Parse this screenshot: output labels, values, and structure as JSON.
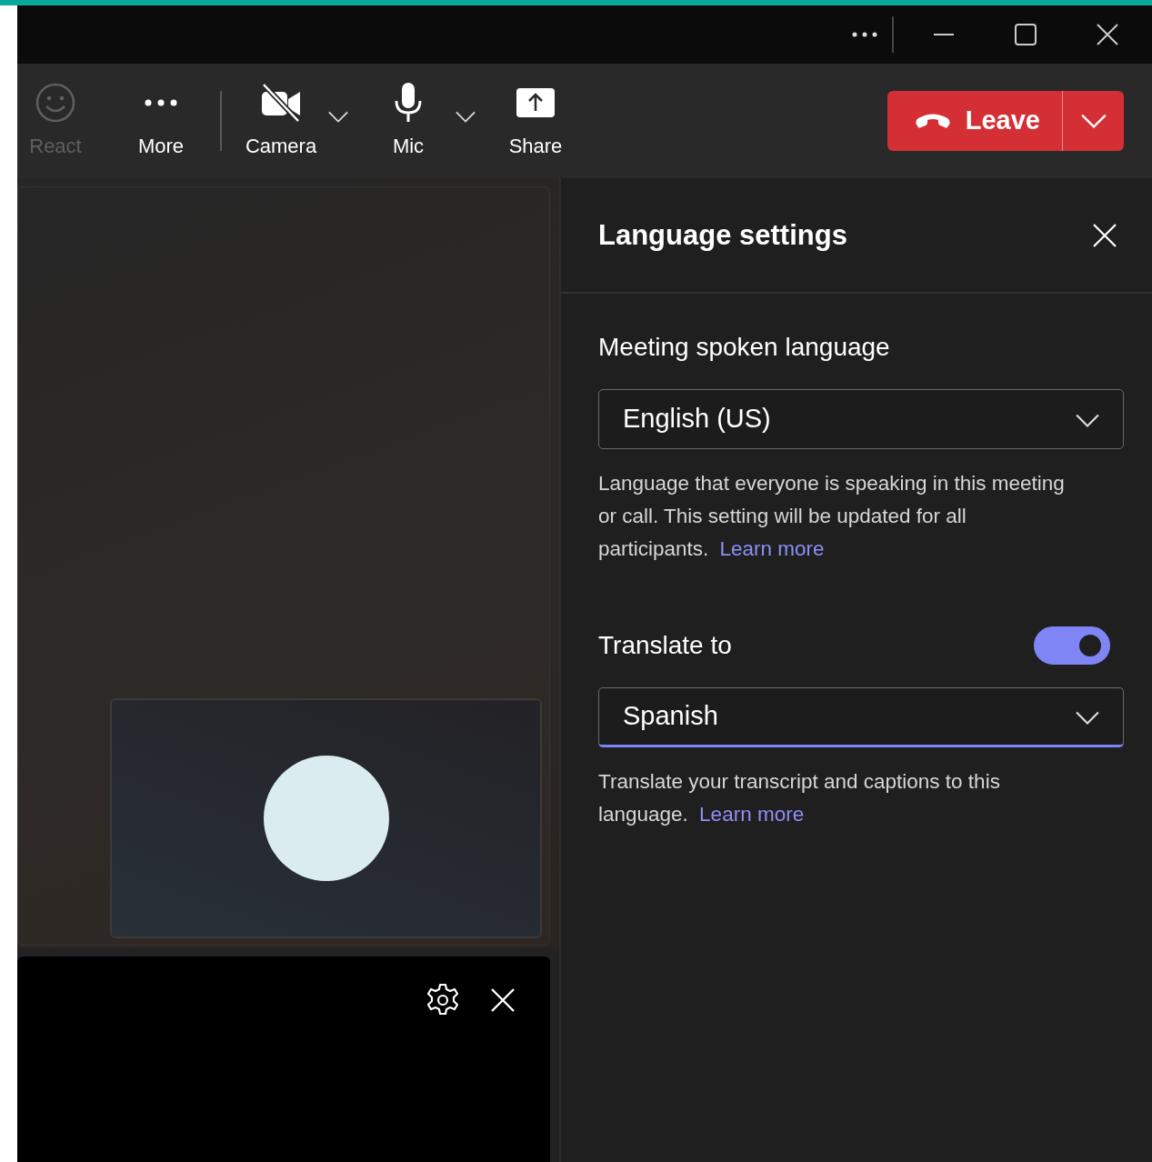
{
  "title_bar": {
    "buttons": [
      {
        "kind": "more"
      },
      {
        "kind": "minimize"
      },
      {
        "kind": "maximize"
      },
      {
        "kind": "close"
      }
    ]
  },
  "toolbar": {
    "items": [
      {
        "kind": "react",
        "label": "React",
        "disabled": true,
        "has_menu": false
      },
      {
        "kind": "more",
        "label": "More",
        "disabled": false,
        "has_menu": false
      },
      {
        "kind": "camera",
        "label": "Camera",
        "disabled": false,
        "has_menu": true
      },
      {
        "kind": "mic",
        "label": "Mic",
        "disabled": false,
        "has_menu": true
      },
      {
        "kind": "share",
        "label": "Share",
        "disabled": false,
        "has_menu": false
      }
    ],
    "leave": {
      "label": "Leave"
    }
  },
  "panel": {
    "title": "Language settings",
    "sections": [
      {
        "label": "Meeting spoken language",
        "value": "English (US)",
        "focused": false,
        "description": "Language that everyone is speaking in this meeting or call. This setting will be updated for all participants.",
        "link": "Learn more"
      },
      {
        "label": "Translate to",
        "toggle": {
          "on": true
        },
        "value": "Spanish",
        "focused": true,
        "description": "Translate your transcript and captions to this language.",
        "link": "Learn more"
      }
    ]
  }
}
